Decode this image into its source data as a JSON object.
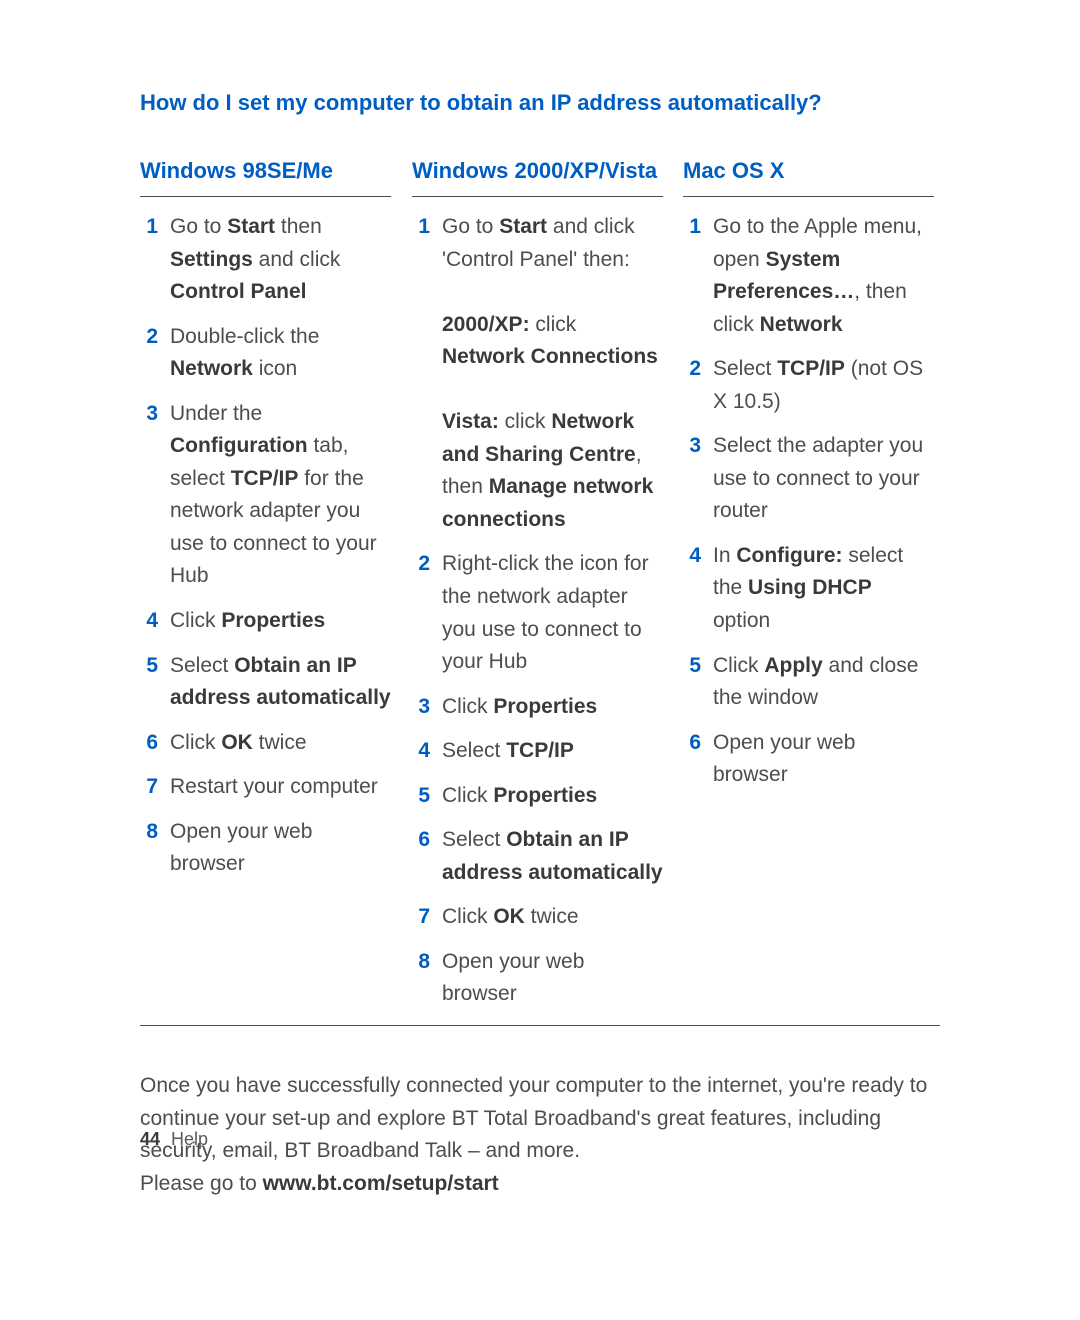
{
  "question": "How do I set my computer to obtain an IP address automatically?",
  "columns": [
    {
      "heading": "Windows 98SE/Me",
      "steps": [
        {
          "n": "1",
          "html": "Go to <span class='b'>Start</span> then <span class='b'>Settings</span> and click <span class='b'>Control Panel</span>"
        },
        {
          "n": "2",
          "html": "Double-click the <span class='b'>Network</span> icon"
        },
        {
          "n": "3",
          "html": "Under the <span class='b'>Configuration</span> tab, select <span class='b'>TCP/IP</span> for the network adapter you use to connect to your Hub"
        },
        {
          "n": "4",
          "html": "Click <span class='b'>Properties</span>"
        },
        {
          "n": "5",
          "html": "Select <span class='b'>Obtain an IP address automatically</span>"
        },
        {
          "n": "6",
          "html": "Click <span class='b'>OK</span> twice"
        },
        {
          "n": "7",
          "html": "Restart your computer"
        },
        {
          "n": "8",
          "html": "Open your web browser"
        }
      ]
    },
    {
      "heading": "Windows 2000/XP/Vista",
      "steps": [
        {
          "n": "1",
          "html": "Go to <span class='b'>Start</span> and click 'Control Panel' then:<br><br><span class='b'>2000/XP:</span> click <span class='b'>Network Connections</span><br><br><span class='b'>Vista:</span> click <span class='b'>Network and Sharing Centre</span>, then <span class='b'>Manage network connections</span>"
        },
        {
          "n": "2",
          "html": "Right-click the icon for the network adapter you use to connect to your Hub"
        },
        {
          "n": "3",
          "html": "Click <span class='b'>Properties</span>"
        },
        {
          "n": "4",
          "html": "Select <span class='b'>TCP/IP</span>"
        },
        {
          "n": "5",
          "html": "Click <span class='b'>Properties</span>"
        },
        {
          "n": "6",
          "html": "Select <span class='b'>Obtain an IP address automatically</span>"
        },
        {
          "n": "7",
          "html": "Click <span class='b'>OK</span> twice"
        },
        {
          "n": "8",
          "html": "Open your web browser"
        }
      ]
    },
    {
      "heading": "Mac OS X",
      "steps": [
        {
          "n": "1",
          "html": "Go to the Apple menu, open <span class='b'>System Preferences…</span>, then click <span class='b'>Network</span>"
        },
        {
          "n": "2",
          "html": "Select <span class='b'>TCP/IP</span> (not OS X 10.5)"
        },
        {
          "n": "3",
          "html": "Select the adapter you use to connect to your router"
        },
        {
          "n": "4",
          "html": "In <span class='b'>Configure:</span> select the <span class='b'>Using DHCP</span> option"
        },
        {
          "n": "5",
          "html": "Click <span class='b'>Apply</span> and close the window"
        },
        {
          "n": "6",
          "html": "Open your web browser"
        }
      ]
    }
  ],
  "after_html": "Once you have successfully connected your computer to the internet, you're ready to continue your set-up and explore BT Total Broadband's great features, including security, email, BT Broadband Talk – and more.<br>Please go to <span class='b'>www.bt.com/setup/start</span>",
  "footer": {
    "page": "44",
    "section": "Help"
  }
}
